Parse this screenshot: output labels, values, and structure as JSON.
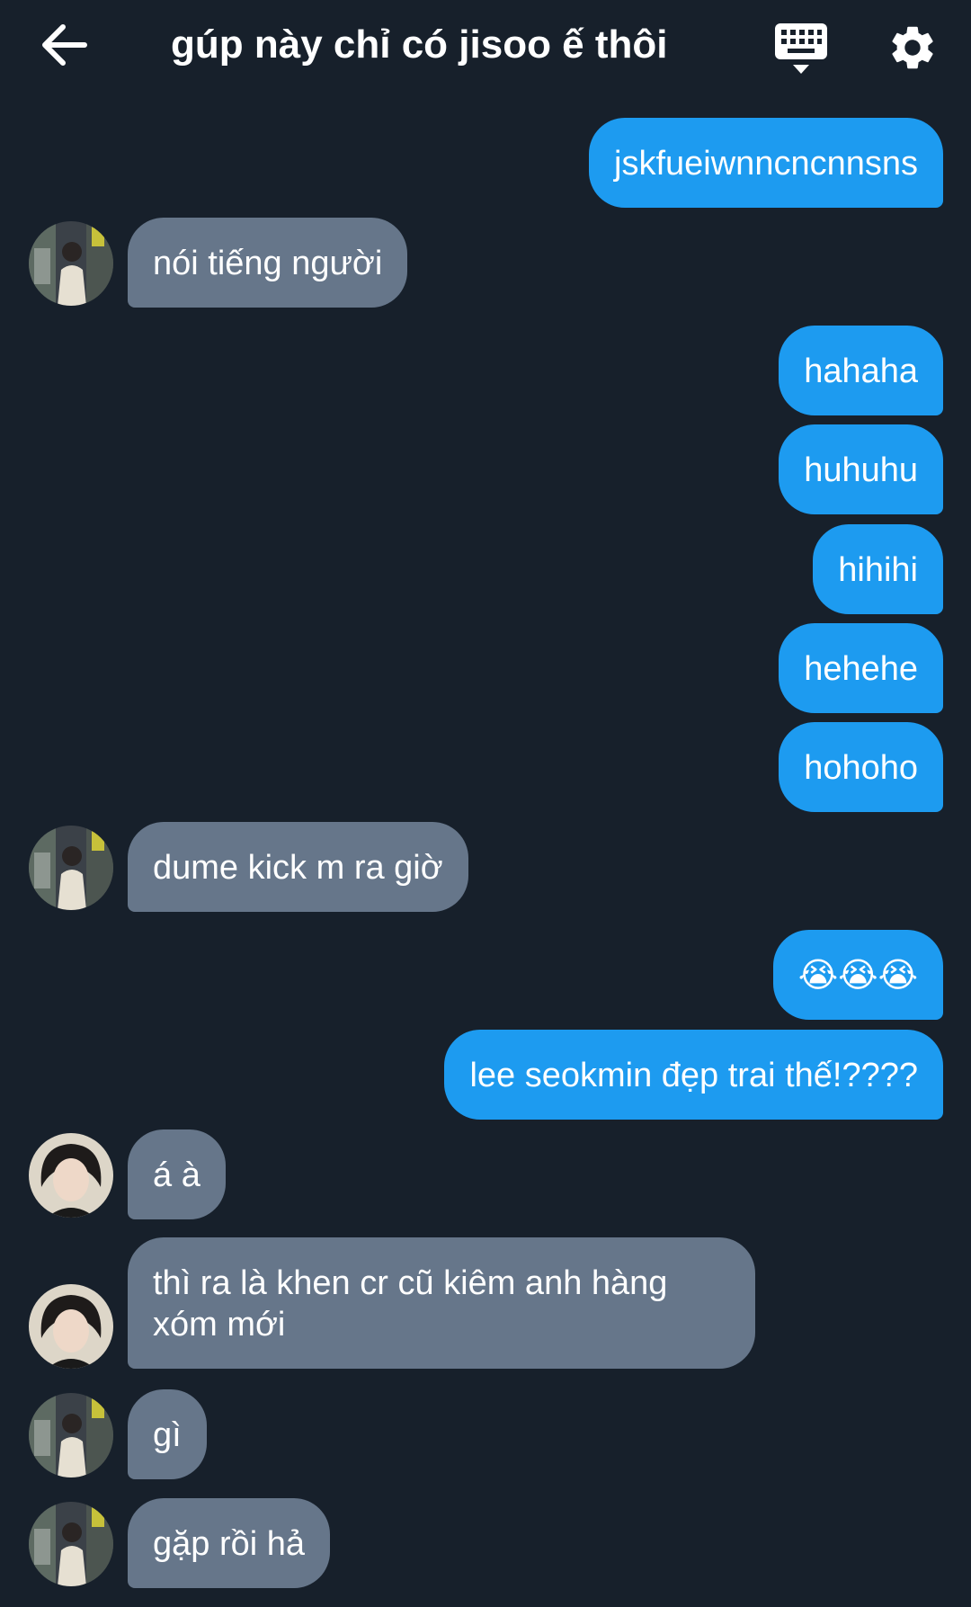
{
  "header": {
    "title": "gúp này chỉ có jisoo ế thôi",
    "back_icon": "arrow-left-icon",
    "keyboard_icon": "keyboard-icon",
    "settings_icon": "gear-icon"
  },
  "colors": {
    "background": "#17202b",
    "outgoing_bubble": "#1d9bf0",
    "incoming_bubble": "#66768a"
  },
  "messages": [
    {
      "dir": "out",
      "text": "jskfueiwnncncnnsns"
    },
    {
      "dir": "in",
      "text": "nói tiếng người",
      "avatar": "avatar-photo-1"
    },
    {
      "dir": "out",
      "text": "hahaha"
    },
    {
      "dir": "out",
      "text": "huhuhu"
    },
    {
      "dir": "out",
      "text": "hihihi"
    },
    {
      "dir": "out",
      "text": "hehehe"
    },
    {
      "dir": "out",
      "text": "hohoho"
    },
    {
      "dir": "in",
      "text": "dume kick m ra giờ",
      "avatar": "avatar-photo-1"
    },
    {
      "dir": "out",
      "text": "😭😭😭"
    },
    {
      "dir": "out",
      "text": "lee seokmin đẹp trai thế!????"
    },
    {
      "dir": "in",
      "text": "á à",
      "avatar": "avatar-photo-2"
    },
    {
      "dir": "in",
      "text": "thì ra là khen cr cũ kiêm anh hàng xóm mới",
      "avatar": "avatar-photo-2"
    },
    {
      "dir": "in",
      "text": "gì",
      "avatar": "avatar-photo-1"
    },
    {
      "dir": "in",
      "text": "gặp rồi hả",
      "avatar": "avatar-photo-1"
    }
  ]
}
